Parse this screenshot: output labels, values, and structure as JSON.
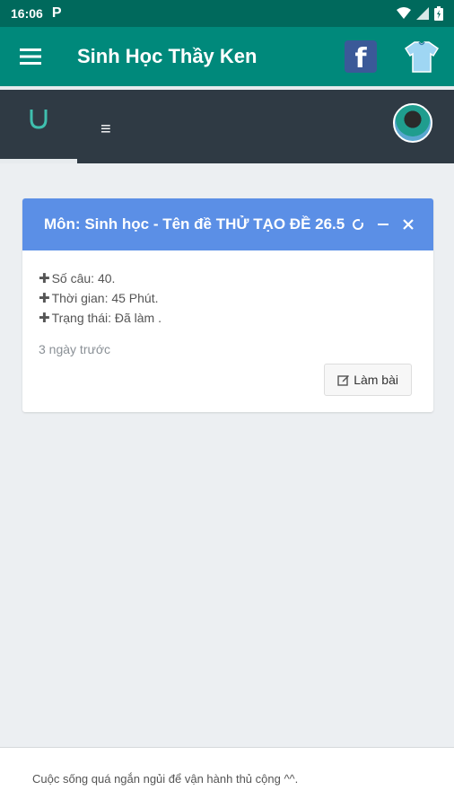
{
  "status_bar": {
    "time": "16:06",
    "p_icon": "P"
  },
  "app_bar": {
    "title": "Sinh Học Thầy Ken",
    "facebook_letter": "f"
  },
  "card": {
    "title": "Môn: Sinh học - Tên đề THỬ TẠO ĐỀ 26.5",
    "fields": [
      {
        "label": "Số câu: 40."
      },
      {
        "label": "Thời gian: 45 Phút."
      },
      {
        "label": "Trạng thái: Đã làm ."
      }
    ],
    "time_ago": "3 ngày trước",
    "action_label": "Làm bài"
  },
  "footer": {
    "text": "Cuộc sống quá ngắn ngủi để vận hành thủ cộng ^^."
  },
  "colors": {
    "status_bar": "#00695c",
    "app_bar": "#00897b",
    "nav2": "#2f3a44",
    "card_header": "#5b8fe6",
    "background": "#eceff2"
  },
  "icons": {
    "menu": "hamburger-icon",
    "facebook": "facebook-icon",
    "shirt": "shirt-icon",
    "tab": "magnet-u-icon",
    "list": "list-icon",
    "avatar": "user-avatar",
    "refresh": "refresh-icon",
    "minimize": "minus-icon",
    "close": "close-icon",
    "edit": "edit-icon"
  }
}
